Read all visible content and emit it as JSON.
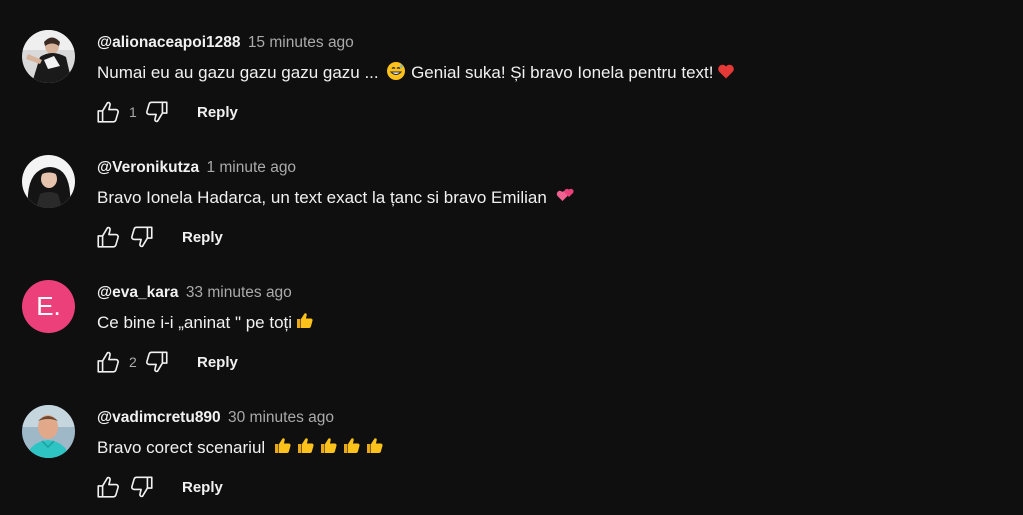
{
  "comments": [
    {
      "author": "@alionaceapoi1288",
      "time": "15 minutes ago",
      "text": "Numai eu au gazu gazu gazu gazu ... ",
      "text2": " Genial suka! Și bravo Ionela pentru text!",
      "emojis": [
        "grinning-sweat-emoji",
        "red-heart-emoji"
      ],
      "likes": "1",
      "reply_label": "Reply"
    },
    {
      "author": "@Veronikutza",
      "time": "1 minute ago",
      "text": "Bravo Ionela Hadarca, un text exact la țanc si bravo Emilian ",
      "emojis": [
        "two-hearts-emoji"
      ],
      "likes": "",
      "reply_label": "Reply"
    },
    {
      "author": "@eva_kara",
      "time": "33 minutes ago",
      "text": "Ce bine i-i „aninat \" pe toți",
      "emojis": [
        "thumbs-up-emoji"
      ],
      "avatar_letter": "E.",
      "avatar_color": "#ec407a",
      "likes": "2",
      "reply_label": "Reply"
    },
    {
      "author": "@vadimcretu890",
      "time": "30 minutes ago",
      "text": "Bravo corect scenariul ",
      "emojis": [
        "thumbs-up-emoji",
        "thumbs-up-emoji",
        "thumbs-up-emoji",
        "thumbs-up-emoji",
        "thumbs-up-emoji"
      ],
      "likes": "",
      "reply_label": "Reply"
    }
  ],
  "colors": {
    "background": "#0f0f0f",
    "text": "#f1f1f1",
    "secondary_text": "#aaaaaa"
  }
}
